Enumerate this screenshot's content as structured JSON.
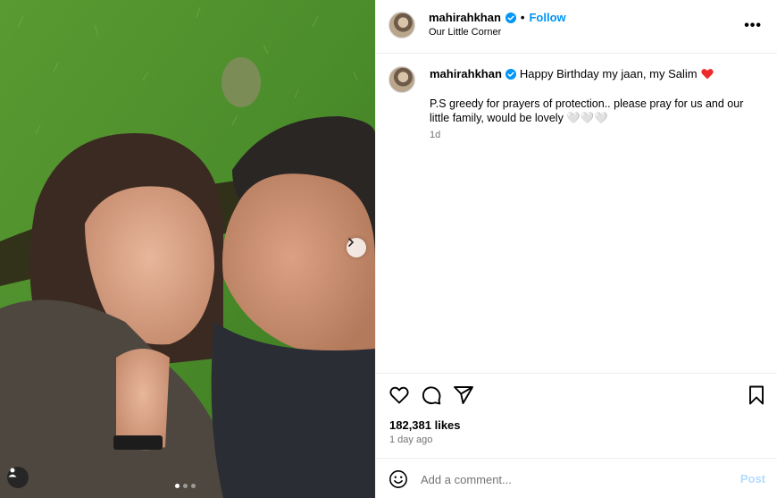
{
  "photo": {
    "carousel_total": 3,
    "carousel_active": 1
  },
  "post": {
    "username": "mahirahkhan",
    "separator": "•",
    "follow_label": "Follow",
    "location": "Our Little Corner",
    "more_label": "•••"
  },
  "caption": {
    "username": "mahirahkhan",
    "text": "Happy Birthday my jaan, my Salim",
    "body": "P.S greedy for prayers of protection.. please pray for us and our little family, would be lovely 🤍🤍🤍",
    "time": "1d"
  },
  "stats": {
    "likes": "182,381 likes",
    "posted": "1 day ago"
  },
  "comment": {
    "placeholder": "Add a comment...",
    "post_label": "Post"
  },
  "colors": {
    "accent": "#0095f6",
    "verified": "#0095f6",
    "heart": "#ed2b2b",
    "post_disabled": "#b3dbff"
  },
  "icons": [
    "verified-icon",
    "more-icon",
    "heart-icon",
    "comment-icon",
    "share-icon",
    "save-icon",
    "emoji-icon",
    "chevron-right-icon",
    "user-tag-icon"
  ]
}
